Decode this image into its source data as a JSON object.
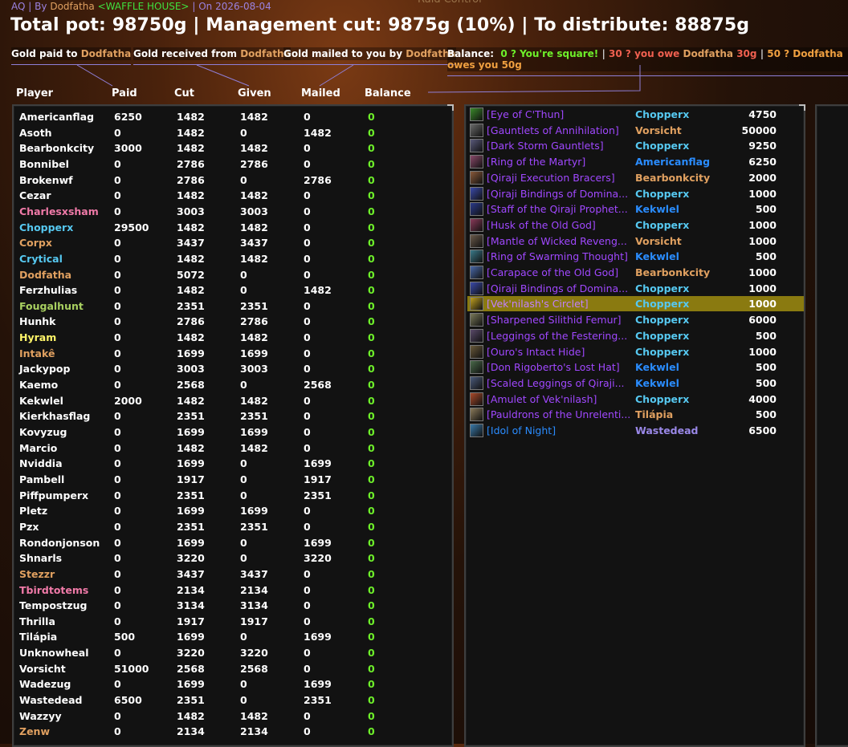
{
  "header": {
    "raid": "AQ",
    "by_label": "By",
    "author": "Dodfatha",
    "guild": "<WAFFLE HOUSE>",
    "on_label": "On",
    "date": "2026-08-04",
    "sep": "|",
    "pot_line": "Total pot: 98750g | Management cut: 9875g (10%) | To distribute: 88875g"
  },
  "legend": {
    "paid_prefix": "Gold paid to",
    "paid_name": "Dodfatha",
    "received_prefix": "Gold received from",
    "received_name": "Dodfatha",
    "mailed_prefix": "Gold mailed to you by",
    "mailed_name": "Dodfatha",
    "balance_label": "Balance:",
    "balance_square": "0 ? You're square!",
    "balance_owe_prefix": "30 ? you owe",
    "balance_owe_name": "Dodfatha",
    "balance_owe_amount": "30g",
    "balance_owes_you": "50 ? Dodfatha owes you 50g",
    "pipe": "|"
  },
  "columns": {
    "player": "Player",
    "paid": "Paid",
    "cut": "Cut",
    "given": "Given",
    "mailed": "Mailed",
    "balance": "Balance"
  },
  "colors": {
    "druid": "#e0a060",
    "shaman": "#2a8cff",
    "mage": "#56c8f0",
    "rogue": "#fff569",
    "hunter": "#a8d060",
    "paladin": "#f07aa8",
    "warlock": "#9a88e8",
    "white": "#ffffff",
    "balance_green": "#6ef02a",
    "epic": "#a048ff",
    "rare": "#2a8cff",
    "highlight": "#8a7a10"
  },
  "players": [
    {
      "name": "Americanflag",
      "color": "#ffffff",
      "paid": "6250",
      "cut": "1482",
      "given": "1482",
      "mailed": "0",
      "balance": "0"
    },
    {
      "name": "Asoth",
      "color": "#ffffff",
      "paid": "0",
      "cut": "1482",
      "given": "0",
      "mailed": "1482",
      "balance": "0"
    },
    {
      "name": "Bearbonkcity",
      "color": "#ffffff",
      "paid": "3000",
      "cut": "1482",
      "given": "1482",
      "mailed": "0",
      "balance": "0"
    },
    {
      "name": "Bonnibel",
      "color": "#ffffff",
      "paid": "0",
      "cut": "2786",
      "given": "2786",
      "mailed": "0",
      "balance": "0"
    },
    {
      "name": "Brokenwf",
      "color": "#ffffff",
      "paid": "0",
      "cut": "2786",
      "given": "0",
      "mailed": "2786",
      "balance": "0"
    },
    {
      "name": "Cezar",
      "color": "#ffffff",
      "paid": "0",
      "cut": "1482",
      "given": "1482",
      "mailed": "0",
      "balance": "0"
    },
    {
      "name": "Charlesxsham",
      "color": "#f07aa8",
      "paid": "0",
      "cut": "3003",
      "given": "3003",
      "mailed": "0",
      "balance": "0"
    },
    {
      "name": "Chopperx",
      "color": "#56c8f0",
      "paid": "29500",
      "cut": "1482",
      "given": "1482",
      "mailed": "0",
      "balance": "0"
    },
    {
      "name": "Corpx",
      "color": "#e0a060",
      "paid": "0",
      "cut": "3437",
      "given": "3437",
      "mailed": "0",
      "balance": "0"
    },
    {
      "name": "Crytical",
      "color": "#56c8f0",
      "paid": "0",
      "cut": "1482",
      "given": "1482",
      "mailed": "0",
      "balance": "0"
    },
    {
      "name": "Dodfatha",
      "color": "#e0a060",
      "paid": "0",
      "cut": "5072",
      "given": "0",
      "mailed": "0",
      "balance": "0"
    },
    {
      "name": "Ferzhulias",
      "color": "#ffffff",
      "paid": "0",
      "cut": "1482",
      "given": "0",
      "mailed": "1482",
      "balance": "0"
    },
    {
      "name": "Fougalhunt",
      "color": "#a8d060",
      "paid": "0",
      "cut": "2351",
      "given": "2351",
      "mailed": "0",
      "balance": "0"
    },
    {
      "name": "Hunhk",
      "color": "#ffffff",
      "paid": "0",
      "cut": "2786",
      "given": "2786",
      "mailed": "0",
      "balance": "0"
    },
    {
      "name": "Hyram",
      "color": "#fff569",
      "paid": "0",
      "cut": "1482",
      "given": "1482",
      "mailed": "0",
      "balance": "0"
    },
    {
      "name": "Intakê",
      "color": "#e0a060",
      "paid": "0",
      "cut": "1699",
      "given": "1699",
      "mailed": "0",
      "balance": "0"
    },
    {
      "name": "Jackypop",
      "color": "#ffffff",
      "paid": "0",
      "cut": "3003",
      "given": "3003",
      "mailed": "0",
      "balance": "0"
    },
    {
      "name": "Kaemo",
      "color": "#ffffff",
      "paid": "0",
      "cut": "2568",
      "given": "0",
      "mailed": "2568",
      "balance": "0"
    },
    {
      "name": "Kekwlel",
      "color": "#ffffff",
      "paid": "2000",
      "cut": "1482",
      "given": "1482",
      "mailed": "0",
      "balance": "0"
    },
    {
      "name": "Kierkhasflag",
      "color": "#ffffff",
      "paid": "0",
      "cut": "2351",
      "given": "2351",
      "mailed": "0",
      "balance": "0"
    },
    {
      "name": "Kovyzug",
      "color": "#ffffff",
      "paid": "0",
      "cut": "1699",
      "given": "1699",
      "mailed": "0",
      "balance": "0"
    },
    {
      "name": "Marcio",
      "color": "#ffffff",
      "paid": "0",
      "cut": "1482",
      "given": "1482",
      "mailed": "0",
      "balance": "0"
    },
    {
      "name": "Nviddia",
      "color": "#ffffff",
      "paid": "0",
      "cut": "1699",
      "given": "0",
      "mailed": "1699",
      "balance": "0"
    },
    {
      "name": "Pambell",
      "color": "#ffffff",
      "paid": "0",
      "cut": "1917",
      "given": "0",
      "mailed": "1917",
      "balance": "0"
    },
    {
      "name": "Piffpumperx",
      "color": "#ffffff",
      "paid": "0",
      "cut": "2351",
      "given": "0",
      "mailed": "2351",
      "balance": "0"
    },
    {
      "name": "Pletz",
      "color": "#ffffff",
      "paid": "0",
      "cut": "1699",
      "given": "1699",
      "mailed": "0",
      "balance": "0"
    },
    {
      "name": "Pzx",
      "color": "#ffffff",
      "paid": "0",
      "cut": "2351",
      "given": "2351",
      "mailed": "0",
      "balance": "0"
    },
    {
      "name": "Rondonjonson",
      "color": "#ffffff",
      "paid": "0",
      "cut": "1699",
      "given": "0",
      "mailed": "1699",
      "balance": "0"
    },
    {
      "name": "Shnarls",
      "color": "#ffffff",
      "paid": "0",
      "cut": "3220",
      "given": "0",
      "mailed": "3220",
      "balance": "0"
    },
    {
      "name": "Stezzr",
      "color": "#e0a060",
      "paid": "0",
      "cut": "3437",
      "given": "3437",
      "mailed": "0",
      "balance": "0"
    },
    {
      "name": "Tbirdtotems",
      "color": "#f07aa8",
      "paid": "0",
      "cut": "2134",
      "given": "2134",
      "mailed": "0",
      "balance": "0"
    },
    {
      "name": "Tempostzug",
      "color": "#ffffff",
      "paid": "0",
      "cut": "3134",
      "given": "3134",
      "mailed": "0",
      "balance": "0"
    },
    {
      "name": "Thrilla",
      "color": "#ffffff",
      "paid": "0",
      "cut": "1917",
      "given": "1917",
      "mailed": "0",
      "balance": "0"
    },
    {
      "name": "Tilápia",
      "color": "#ffffff",
      "paid": "500",
      "cut": "1699",
      "given": "0",
      "mailed": "1699",
      "balance": "0"
    },
    {
      "name": "Unknowheal",
      "color": "#ffffff",
      "paid": "0",
      "cut": "3220",
      "given": "3220",
      "mailed": "0",
      "balance": "0"
    },
    {
      "name": "Vorsicht",
      "color": "#ffffff",
      "paid": "51000",
      "cut": "2568",
      "given": "2568",
      "mailed": "0",
      "balance": "0"
    },
    {
      "name": "Wadezug",
      "color": "#ffffff",
      "paid": "0",
      "cut": "1699",
      "given": "0",
      "mailed": "1699",
      "balance": "0"
    },
    {
      "name": "Wastedead",
      "color": "#ffffff",
      "paid": "6500",
      "cut": "2351",
      "given": "0",
      "mailed": "2351",
      "balance": "0"
    },
    {
      "name": "Wazzyy",
      "color": "#ffffff",
      "paid": "0",
      "cut": "1482",
      "given": "1482",
      "mailed": "0",
      "balance": "0"
    },
    {
      "name": "Zenw",
      "color": "#e0a060",
      "paid": "0",
      "cut": "2134",
      "given": "2134",
      "mailed": "0",
      "balance": "0"
    }
  ],
  "items": [
    {
      "name": "[Eye of C'Thun]",
      "quality": "epic",
      "icon": "eye-icon",
      "icon_color": "#3a8a2a",
      "winner": "Chopperx",
      "winner_color": "#56c8f0",
      "amount": "4750"
    },
    {
      "name": "[Gauntlets of Annihilation]",
      "quality": "epic",
      "icon": "gauntlet-icon",
      "icon_color": "#6a6a6a",
      "winner": "Vorsicht",
      "winner_color": "#e0a060",
      "amount": "50000"
    },
    {
      "name": "[Dark Storm Gauntlets]",
      "quality": "epic",
      "icon": "gauntlet-icon",
      "icon_color": "#5a5a7a",
      "winner": "Chopperx",
      "winner_color": "#56c8f0",
      "amount": "9250"
    },
    {
      "name": "[Ring of the Martyr]",
      "quality": "epic",
      "icon": "ring-icon",
      "icon_color": "#8a4a6a",
      "winner": "Americanflag",
      "winner_color": "#2a8cff",
      "amount": "6250"
    },
    {
      "name": "[Qiraji Execution Bracers]",
      "quality": "epic",
      "icon": "bracer-icon",
      "icon_color": "#8a5a3a",
      "winner": "Bearbonkcity",
      "winner_color": "#e0a060",
      "amount": "2000"
    },
    {
      "name": "[Qiraji Bindings of Domina...",
      "quality": "epic",
      "icon": "bindings-icon",
      "icon_color": "#3a4aaa",
      "winner": "Chopperx",
      "winner_color": "#56c8f0",
      "amount": "1000"
    },
    {
      "name": "[Staff of the Qiraji Prophet...",
      "quality": "epic",
      "icon": "staff-icon",
      "icon_color": "#2a3a8a",
      "winner": "Kekwlel",
      "winner_color": "#2a8cff",
      "amount": "500"
    },
    {
      "name": "[Husk of the Old God]",
      "quality": "epic",
      "icon": "husk-icon",
      "icon_color": "#8a3a5a",
      "winner": "Chopperx",
      "winner_color": "#56c8f0",
      "amount": "1000"
    },
    {
      "name": "[Mantle of Wicked Reveng...",
      "quality": "epic",
      "icon": "mantle-icon",
      "icon_color": "#6a5a4a",
      "winner": "Vorsicht",
      "winner_color": "#e0a060",
      "amount": "1000"
    },
    {
      "name": "[Ring of Swarming Thought]",
      "quality": "epic",
      "icon": "ring-icon",
      "icon_color": "#3a7a8a",
      "winner": "Kekwlel",
      "winner_color": "#2a8cff",
      "amount": "500"
    },
    {
      "name": "[Carapace of the Old God]",
      "quality": "epic",
      "icon": "carapace-icon",
      "icon_color": "#4a6aaa",
      "winner": "Bearbonkcity",
      "winner_color": "#e0a060",
      "amount": "1000"
    },
    {
      "name": "[Qiraji Bindings of Domina...",
      "quality": "epic",
      "icon": "bindings-icon",
      "icon_color": "#3a4aaa",
      "winner": "Chopperx",
      "winner_color": "#56c8f0",
      "amount": "1000"
    },
    {
      "name": "[Vek'nilash's Circlet]",
      "quality": "epic",
      "icon": "circlet-icon",
      "icon_color": "#c0a020",
      "winner": "Chopperx",
      "winner_color": "#56c8f0",
      "amount": "1000",
      "highlight": true
    },
    {
      "name": "[Sharpened Silithid Femur]",
      "quality": "epic",
      "icon": "femur-icon",
      "icon_color": "#7a7a5a",
      "winner": "Chopperx",
      "winner_color": "#56c8f0",
      "amount": "6000"
    },
    {
      "name": "[Leggings of the Festering...",
      "quality": "epic",
      "icon": "leggings-icon",
      "icon_color": "#5a4a6a",
      "winner": "Chopperx",
      "winner_color": "#56c8f0",
      "amount": "500"
    },
    {
      "name": "[Ouro's Intact Hide]",
      "quality": "epic",
      "icon": "hide-icon",
      "icon_color": "#6a5a3a",
      "winner": "Chopperx",
      "winner_color": "#56c8f0",
      "amount": "1000"
    },
    {
      "name": "[Don Rigoberto's Lost Hat]",
      "quality": "epic",
      "icon": "hat-icon",
      "icon_color": "#4a6a4a",
      "winner": "Kekwlel",
      "winner_color": "#2a8cff",
      "amount": "500"
    },
    {
      "name": "[Scaled Leggings of Qiraji...",
      "quality": "epic",
      "icon": "leggings-icon",
      "icon_color": "#4a5a7a",
      "winner": "Kekwlel",
      "winner_color": "#2a8cff",
      "amount": "500"
    },
    {
      "name": "[Amulet of Vek'nilash]",
      "quality": "epic",
      "icon": "amulet-icon",
      "icon_color": "#aa4a2a",
      "winner": "Chopperx",
      "winner_color": "#56c8f0",
      "amount": "4000"
    },
    {
      "name": "[Pauldrons of the Unrelenti...",
      "quality": "epic",
      "icon": "pauldron-icon",
      "icon_color": "#8a7a5a",
      "winner": "Tilápia",
      "winner_color": "#e0a060",
      "amount": "500"
    },
    {
      "name": "[Idol of Night]",
      "quality": "rare",
      "icon": "idol-icon",
      "icon_color": "#3a7aaa",
      "winner": "Wastedead",
      "winner_color": "#9a88e8",
      "amount": "6500"
    }
  ]
}
